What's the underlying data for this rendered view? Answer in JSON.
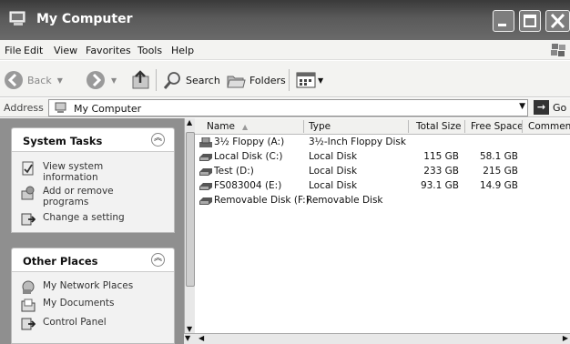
{
  "window": {
    "title": "My Computer"
  },
  "menu": [
    "File",
    "Edit",
    "View",
    "Favorites",
    "Tools",
    "Help"
  ],
  "toolbar": {
    "back": "Back",
    "search": "Search",
    "folders": "Folders"
  },
  "address": {
    "label": "Address",
    "value": "My Computer",
    "go": "Go"
  },
  "system_tasks": {
    "title": "System Tasks",
    "items": [
      "View system information",
      "Add or remove programs",
      "Change a setting"
    ]
  },
  "other_places": {
    "title": "Other Places",
    "items": [
      "My Network Places",
      "My Documents",
      "Control Panel"
    ]
  },
  "columns": [
    "Name",
    "Type",
    "Total Size",
    "Free Space",
    "Comments"
  ],
  "drives": [
    {
      "name": "3½ Floppy (A:)",
      "type": "3½-Inch Floppy Disk",
      "total": "",
      "free": ""
    },
    {
      "name": "Local Disk (C:)",
      "type": "Local Disk",
      "total": "115 GB",
      "free": "58.1 GB"
    },
    {
      "name": "Test (D:)",
      "type": "Local Disk",
      "total": "233 GB",
      "free": "215 GB"
    },
    {
      "name": "FS083004 (E:)",
      "type": "Local Disk",
      "total": "93.1 GB",
      "free": "14.9 GB"
    },
    {
      "name": "Removable Disk (F:)",
      "type": "Removable Disk",
      "total": "",
      "free": ""
    }
  ]
}
